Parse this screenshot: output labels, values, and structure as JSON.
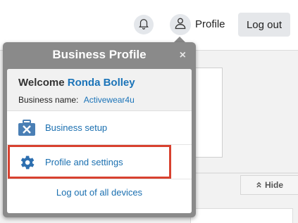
{
  "header": {
    "bell_icon": "bell-icon",
    "user_icon": "user-icon",
    "profile_label": "Profile",
    "logout_label": "Log out"
  },
  "popover": {
    "title": "Business Profile",
    "close_label": "×",
    "welcome_prefix": "Welcome",
    "user_name": "Ronda Bolley",
    "business_name_label": "Business name:",
    "business_name_value": "Activewear4u",
    "items": [
      {
        "label": "Business setup",
        "icon": "briefcase-tools-icon"
      },
      {
        "label": "Profile and settings",
        "icon": "gear-icon"
      }
    ],
    "logout_all_label": "Log out of all devices"
  },
  "background": {
    "hide_label": "Hide",
    "hide_icon": "double-chevron-up-icon"
  },
  "colors": {
    "link": "#1a73b8",
    "popover_bg": "#8a8a8a",
    "highlight": "#d8412f"
  }
}
